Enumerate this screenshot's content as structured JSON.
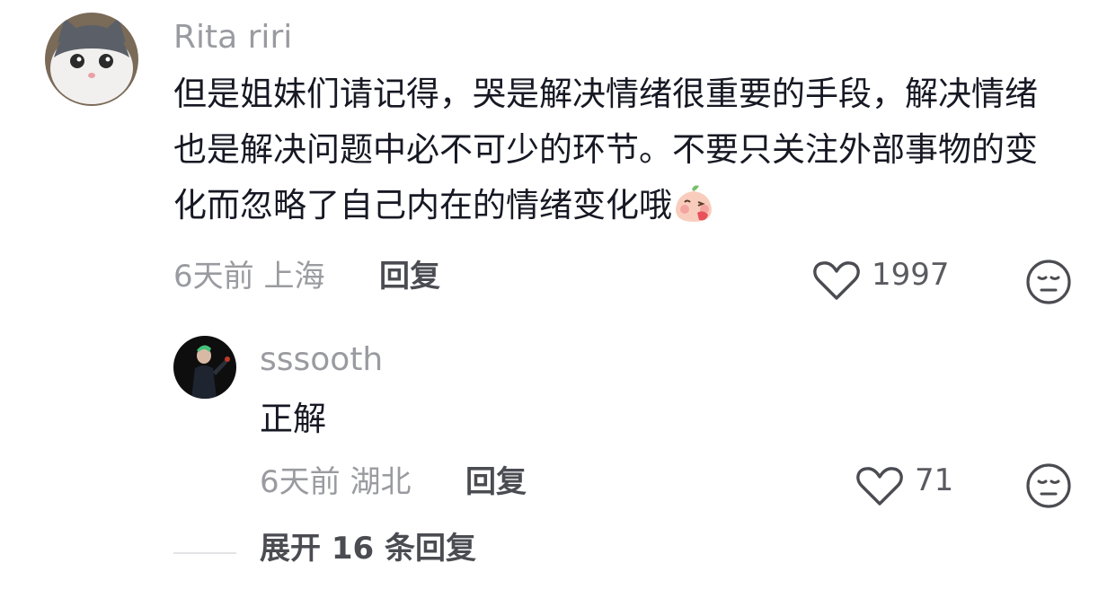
{
  "comment": {
    "username": "Rita riri",
    "text": "但是姐妹们请记得，哭是解决情绪很重要的手段，解决情绪也是解决问题中必不可少的环节。不要只关注外部事物的变化而忽略了自己内在的情绪变化哦",
    "time": "6天前",
    "location": "上海",
    "reply_label": "回复",
    "likes": "1997",
    "emoji_name": "blushing-peach-emoji"
  },
  "sub_reply": {
    "username": "sssooth",
    "text": "正解",
    "time": "6天前",
    "location": "湖北",
    "reply_label": "回复",
    "likes": "71"
  },
  "expand_label": "展开 16 条回复",
  "colors": {
    "secondary_text": "#9a9ba0",
    "primary_text": "#161823",
    "icon_stroke": "#4b4c52"
  }
}
